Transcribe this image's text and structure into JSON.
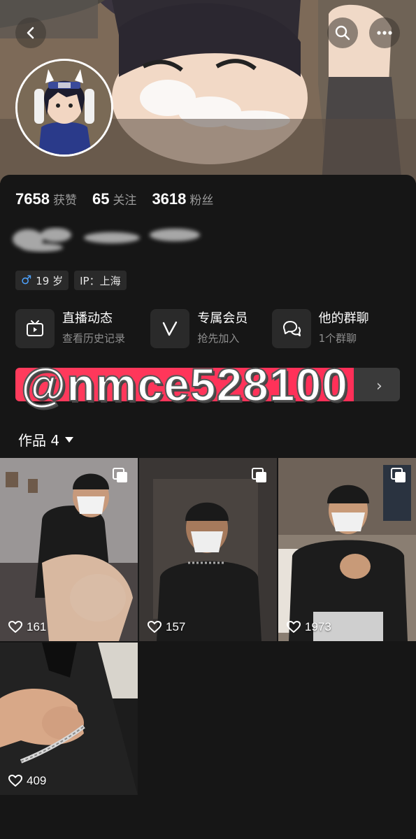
{
  "header": {
    "back_icon": "chevron-left-icon",
    "search_icon": "search-icon",
    "more_icon": "more-dots-icon"
  },
  "stats": [
    {
      "value": "7658",
      "label": "获赞"
    },
    {
      "value": "65",
      "label": "关注"
    },
    {
      "value": "3618",
      "label": "粉丝"
    }
  ],
  "tags": {
    "age": "19 岁",
    "ip": "IP：上海"
  },
  "shortcuts": [
    {
      "title": "直播动态",
      "subtitle": "查看历史记录",
      "icon": "tv-icon"
    },
    {
      "title": "专属会员",
      "subtitle": "抢先加入",
      "icon": "v-icon"
    },
    {
      "title": "他的群聊",
      "subtitle": "1个群聊",
      "icon": "chat-bubbles-icon"
    }
  ],
  "watermark": "@nmce528100",
  "works_tab": {
    "label": "作品 4"
  },
  "posts": [
    {
      "likes": "161"
    },
    {
      "likes": "157"
    },
    {
      "likes": "1973"
    },
    {
      "likes": "409"
    }
  ],
  "colors": {
    "background": "#161616",
    "accent": "#ff2f58",
    "gender": "#4da3ff"
  }
}
